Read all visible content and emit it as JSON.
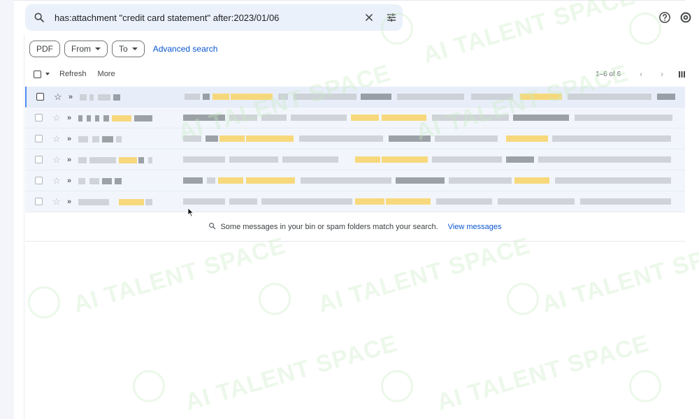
{
  "search": {
    "query": "has:attachment \"credit card statement\" after:2023/01/06"
  },
  "icons": {
    "search": "search-icon",
    "clear": "close-icon",
    "filters": "tune-icon",
    "help": "help-icon",
    "settings": "gear-icon"
  },
  "chips": {
    "pdf": "PDF",
    "from": "From",
    "to": "To",
    "advanced": "Advanced search"
  },
  "toolbar": {
    "refresh": "Refresh",
    "more": "More",
    "range": "1–6 of 6",
    "prev": "‹",
    "next": "›"
  },
  "messages_count": 6,
  "info": {
    "text": "Some messages in your bin or spam folders match your search.",
    "link": "View messages"
  },
  "watermark": "AI TALENT SPACE",
  "colors": {
    "accent": "#0b57d0",
    "search_bg": "#eaf1fb",
    "row_bg": "#f2f6fc",
    "highlight": "#f7d675",
    "watermark": "#c9ecc4"
  }
}
